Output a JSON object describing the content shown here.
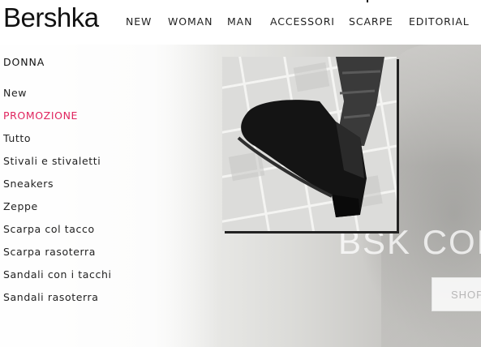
{
  "brand": {
    "logo_text": "Bershka"
  },
  "nav": {
    "items": [
      {
        "label": "NEW"
      },
      {
        "label": "WOMAN"
      },
      {
        "label": "MAN"
      },
      {
        "label": "ACCESSORI"
      },
      {
        "label": "SCARPE"
      },
      {
        "label": "EDITORIAL"
      }
    ]
  },
  "menu": {
    "title": "DONNA",
    "items": [
      {
        "label": "New"
      },
      {
        "label": "PROMOZIONE"
      },
      {
        "label": "Tutto"
      },
      {
        "label": "Stivali e stivaletti"
      },
      {
        "label": "Sneakers"
      },
      {
        "label": "Zeppe"
      },
      {
        "label": "Scarpa col tacco"
      },
      {
        "label": "Scarpa rasoterra"
      },
      {
        "label": "Sandali con i tacchi"
      },
      {
        "label": "Sandali rasoterra"
      }
    ]
  },
  "hero": {
    "headline": "BSK COL",
    "shop_label": "SHOP"
  },
  "colors": {
    "promo": "#e0245e",
    "text": "#222222"
  }
}
